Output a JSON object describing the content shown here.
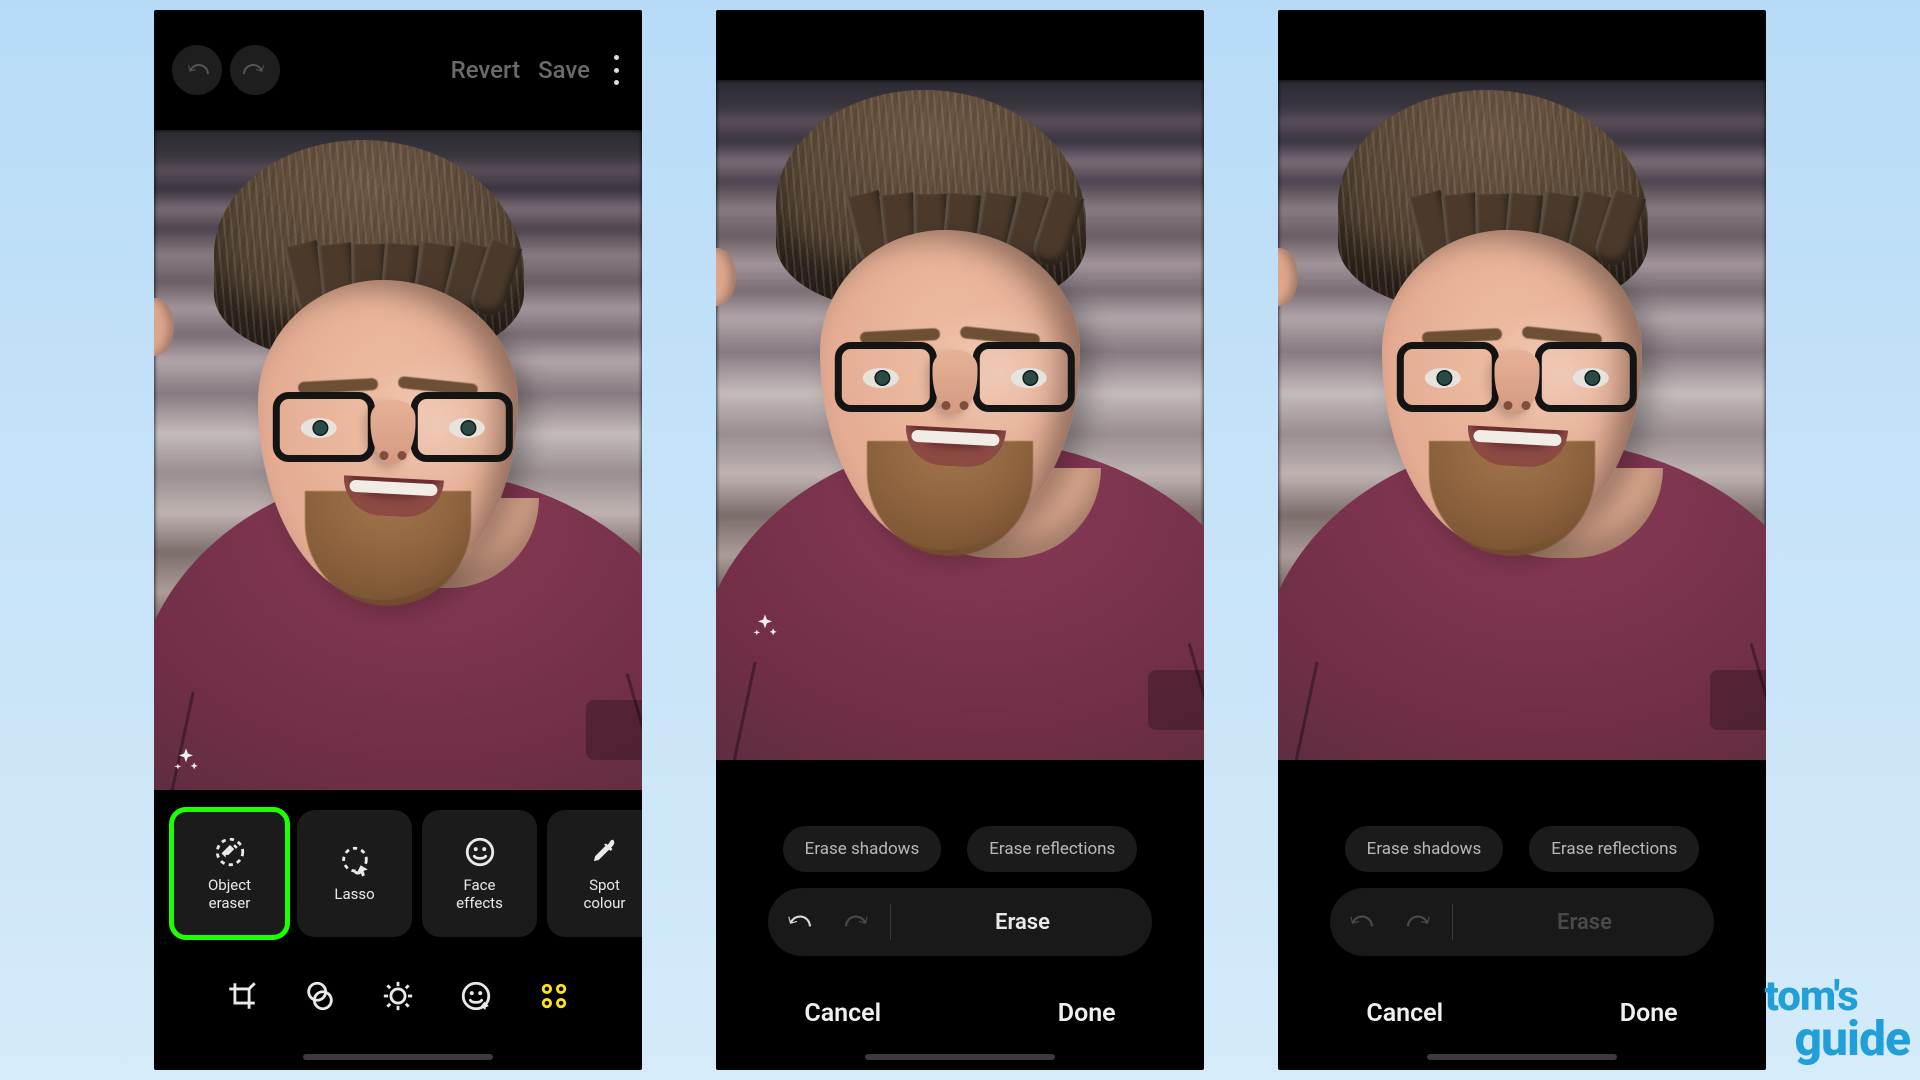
{
  "watermark": {
    "line1": "tom's",
    "line2": "guide"
  },
  "panel1": {
    "topbar": {
      "revert": "Revert",
      "save": "Save"
    },
    "tools": [
      {
        "id": "object-eraser",
        "label": "Object\neraser",
        "highlighted": true
      },
      {
        "id": "lasso",
        "label": "Lasso"
      },
      {
        "id": "face-effects",
        "label": "Face\neffects"
      },
      {
        "id": "spot-colour",
        "label": "Spot\ncolour"
      }
    ],
    "tabs": [
      {
        "id": "crop"
      },
      {
        "id": "filters"
      },
      {
        "id": "adjust"
      },
      {
        "id": "sticker"
      },
      {
        "id": "apps",
        "active": true
      }
    ]
  },
  "panel2": {
    "chips": {
      "shadows": "Erase shadows",
      "reflections": "Erase reflections"
    },
    "pill": {
      "action": "Erase",
      "enabled": true
    },
    "footer": {
      "cancel": "Cancel",
      "done": "Done"
    }
  },
  "panel3": {
    "chips": {
      "shadows": "Erase shadows",
      "reflections": "Erase reflections"
    },
    "pill": {
      "action": "Erase",
      "enabled": false
    },
    "footer": {
      "cancel": "Cancel",
      "done": "Done"
    }
  }
}
